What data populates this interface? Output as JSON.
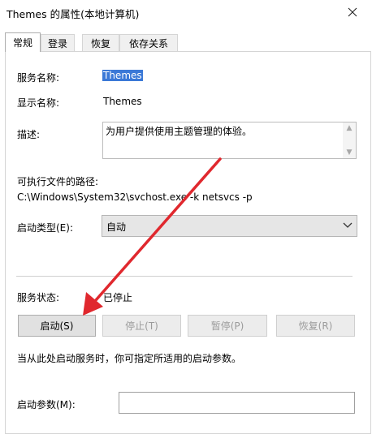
{
  "window": {
    "title": "Themes 的属性(本地计算机)"
  },
  "tabs": [
    {
      "label": "常规",
      "active": true
    },
    {
      "label": "登录",
      "active": false
    },
    {
      "label": "恢复",
      "active": false
    },
    {
      "label": "依存关系",
      "active": false
    }
  ],
  "general": {
    "service_name_label": "服务名称:",
    "service_name_value": "Themes",
    "display_name_label": "显示名称:",
    "display_name_value": "Themes",
    "description_label": "描述:",
    "description_value": "为用户提供使用主题管理的体验。",
    "exe_path_label": "可执行文件的路径:",
    "exe_path_value": "C:\\Windows\\System32\\svchost.exe -k netsvcs -p",
    "startup_type_label": "启动类型(E):",
    "startup_type_value": "自动",
    "service_status_label": "服务状态:",
    "service_status_value": "已停止",
    "buttons": {
      "start": "启动(S)",
      "stop": "停止(T)",
      "pause": "暂停(P)",
      "resume": "恢复(R)"
    },
    "hint": "当从此处启动服务时，你可指定所适用的启动参数。",
    "start_params_label": "启动参数(M):",
    "start_params_value": ""
  },
  "colors": {
    "selection": "#3b79d7",
    "annotation_arrow": "#e0282e"
  },
  "icons": {
    "close": "close-icon",
    "dropdown": "chevron-down-icon"
  }
}
